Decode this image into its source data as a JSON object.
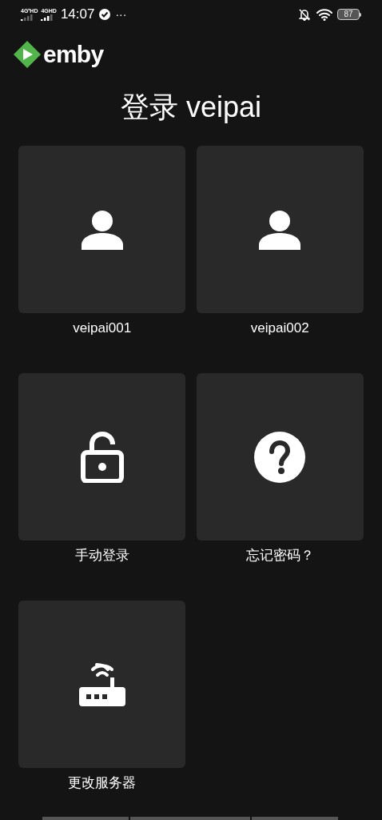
{
  "status_bar": {
    "network_1": "4G⁺HD",
    "network_2": "4GHD",
    "time": "14:07",
    "more": "···",
    "battery": "87"
  },
  "app": {
    "logo_text": "emby"
  },
  "title": "登录 veipai",
  "tiles": [
    {
      "kind": "user",
      "label": "veipai001"
    },
    {
      "kind": "user",
      "label": "veipai002"
    },
    {
      "kind": "manual",
      "label": "手动登录"
    },
    {
      "kind": "forgot",
      "label": "忘记密码？"
    },
    {
      "kind": "server",
      "label": "更改服务器"
    }
  ]
}
